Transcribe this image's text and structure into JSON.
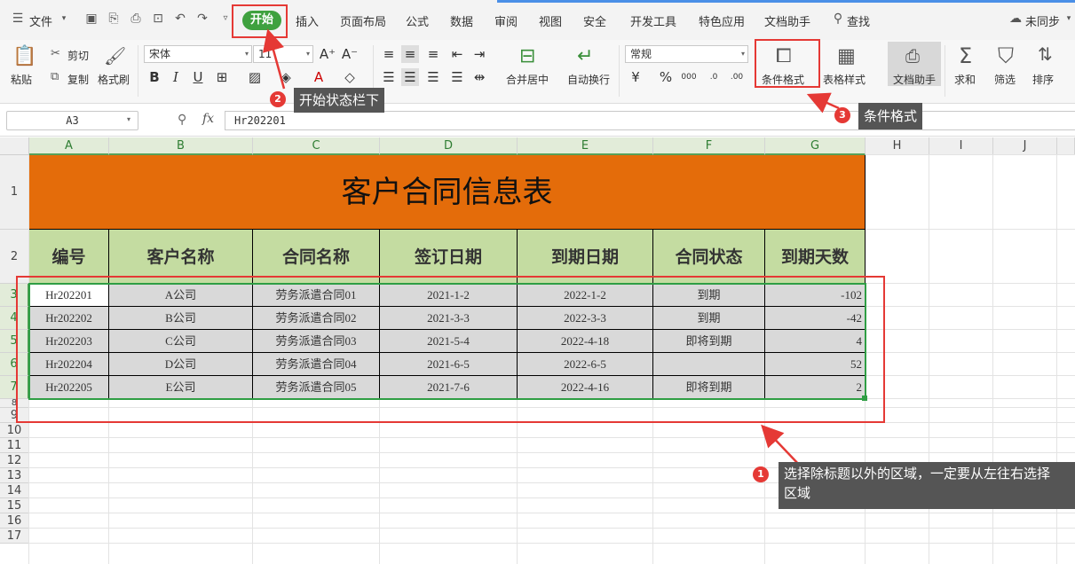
{
  "menubar": {
    "file_label": "文件",
    "tabs": [
      "开始",
      "插入",
      "页面布局",
      "公式",
      "数据",
      "审阅",
      "视图",
      "安全",
      "开发工具",
      "特色应用",
      "文档助手"
    ],
    "search_label": "查找",
    "sync_label": "未同步"
  },
  "ribbon": {
    "paste": "粘贴",
    "cut": "剪切",
    "copy": "复制",
    "format_painter": "格式刷",
    "font_name": "宋体",
    "font_size": "11",
    "merge_center": "合并居中",
    "wrap_text": "自动换行",
    "number_format": "常规",
    "conditional_format": "条件格式",
    "table_style": "表格样式",
    "doc_assistant": "文档助手",
    "sum": "求和",
    "filter": "筛选",
    "sort": "排序"
  },
  "formula_bar": {
    "cell_ref": "A3",
    "fx": "fx",
    "content": "Hr202201"
  },
  "sheet": {
    "columns": [
      "A",
      "B",
      "C",
      "D",
      "E",
      "F",
      "G",
      "H",
      "I",
      "J"
    ],
    "rows": [
      "1",
      "2",
      "3",
      "4",
      "5",
      "6",
      "7",
      "8",
      "9",
      "10",
      "11",
      "12",
      "13",
      "14",
      "15",
      "16",
      "17"
    ],
    "title": "客户合同信息表",
    "headers": [
      "编号",
      "客户名称",
      "合同名称",
      "签订日期",
      "到期日期",
      "合同状态",
      "到期天数"
    ],
    "records": [
      [
        "Hr202201",
        "A公司",
        "劳务派遣合同01",
        "2021-1-2",
        "2022-1-2",
        "到期",
        "-102"
      ],
      [
        "Hr202202",
        "B公司",
        "劳务派遣合同02",
        "2021-3-3",
        "2022-3-3",
        "到期",
        "-42"
      ],
      [
        "Hr202203",
        "C公司",
        "劳务派遣合同03",
        "2021-5-4",
        "2022-4-18",
        "即将到期",
        "4"
      ],
      [
        "Hr202204",
        "D公司",
        "劳务派遣合同04",
        "2021-6-5",
        "2022-6-5",
        "",
        "52"
      ],
      [
        "Hr202205",
        "E公司",
        "劳务派遣合同05",
        "2021-7-6",
        "2022-4-16",
        "即将到期",
        "2"
      ]
    ]
  },
  "annotations": {
    "step1_num": "1",
    "step1_text": "选择除标题以外的区域，一定要从左往右选择",
    "step1_text2": "区域",
    "step2_num": "2",
    "step2_text": "开始状态栏下",
    "step3_num": "3",
    "step3_text": "条件格式"
  },
  "colors": {
    "title_fill": "#e46c0a",
    "header_fill": "#c4dca1",
    "data_fill": "#d9d9d9",
    "accent_green": "#3fa13f",
    "annotation_red": "#e53935"
  }
}
